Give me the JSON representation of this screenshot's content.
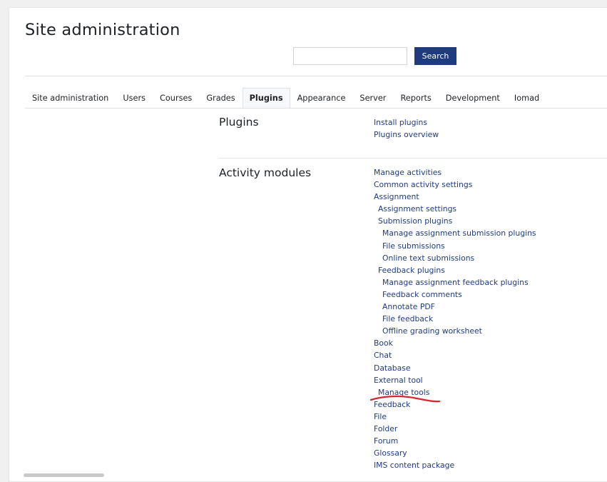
{
  "header": {
    "title": "Site administration",
    "search_placeholder": "",
    "search_button": "Search"
  },
  "tabs": [
    {
      "label": "Site administration",
      "active": false
    },
    {
      "label": "Users",
      "active": false
    },
    {
      "label": "Courses",
      "active": false
    },
    {
      "label": "Grades",
      "active": false
    },
    {
      "label": "Plugins",
      "active": true
    },
    {
      "label": "Appearance",
      "active": false
    },
    {
      "label": "Server",
      "active": false
    },
    {
      "label": "Reports",
      "active": false
    },
    {
      "label": "Development",
      "active": false
    },
    {
      "label": "Iomad",
      "active": false
    }
  ],
  "sections": [
    {
      "title": "Plugins",
      "links": [
        {
          "label": "Install plugins",
          "level": 0
        },
        {
          "label": "Plugins overview",
          "level": 0
        }
      ]
    },
    {
      "title": "Activity modules",
      "links": [
        {
          "label": "Manage activities",
          "level": 0
        },
        {
          "label": "Common activity settings",
          "level": 0
        },
        {
          "label": "Assignment",
          "level": 0
        },
        {
          "label": "Assignment settings",
          "level": 1
        },
        {
          "label": "Submission plugins",
          "level": 1
        },
        {
          "label": "Manage assignment submission plugins",
          "level": 2
        },
        {
          "label": "File submissions",
          "level": 2
        },
        {
          "label": "Online text submissions",
          "level": 2
        },
        {
          "label": "Feedback plugins",
          "level": 1
        },
        {
          "label": "Manage assignment feedback plugins",
          "level": 2
        },
        {
          "label": "Feedback comments",
          "level": 2
        },
        {
          "label": "Annotate PDF",
          "level": 2
        },
        {
          "label": "File feedback",
          "level": 2
        },
        {
          "label": "Offline grading worksheet",
          "level": 2
        },
        {
          "label": "Book",
          "level": 0
        },
        {
          "label": "Chat",
          "level": 0
        },
        {
          "label": "Database",
          "level": 0
        },
        {
          "label": "External tool",
          "level": 0
        },
        {
          "label": "Manage tools",
          "level": 1
        },
        {
          "label": "Feedback",
          "level": 0
        },
        {
          "label": "File",
          "level": 0
        },
        {
          "label": "Folder",
          "level": 0
        },
        {
          "label": "Forum",
          "level": 0
        },
        {
          "label": "Glossary",
          "level": 0
        },
        {
          "label": "IMS content package",
          "level": 0
        }
      ]
    }
  ],
  "colors": {
    "brand": "#1f3b7f",
    "link": "#1f3b7f",
    "annotation": "#d9262e"
  }
}
